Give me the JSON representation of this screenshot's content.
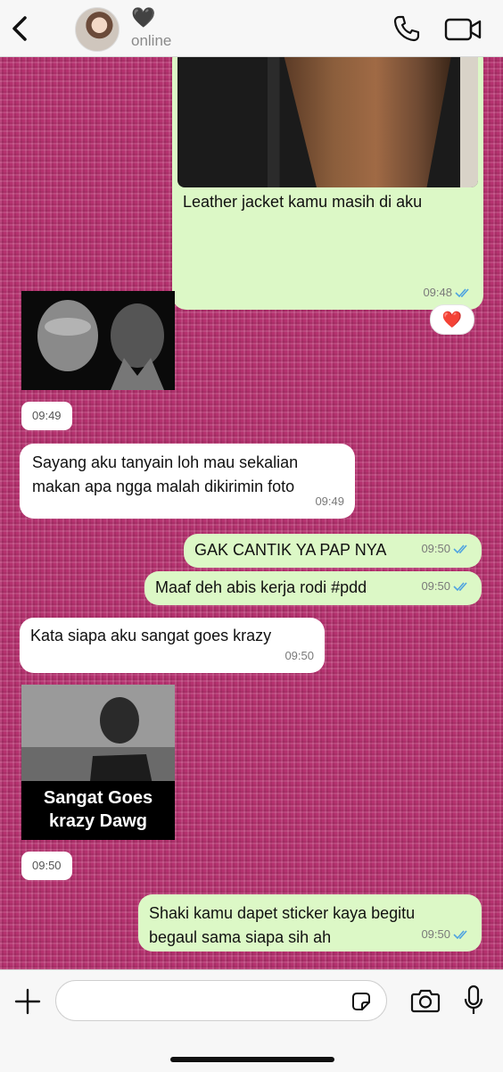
{
  "header": {
    "contact_name": "🖤",
    "status": "online"
  },
  "messages": {
    "m1": {
      "text": "Leather jacket kamu masih di aku",
      "time": "09:48",
      "reaction": "❤️"
    },
    "m2": {
      "time": "09:49"
    },
    "m3": {
      "text": "Sayang aku tanyain loh mau sekalian makan apa ngga malah dikirimin foto",
      "time": "09:49"
    },
    "m4": {
      "text": "GAK CANTIK YA PAP NYA",
      "time": "09:50"
    },
    "m5": {
      "text": "Maaf deh abis kerja rodi #pdd",
      "time": "09:50"
    },
    "m6": {
      "text": "Kata siapa aku sangat goes krazy",
      "time": "09:50"
    },
    "m7": {
      "caption": "Sangat Goes krazy Dawg",
      "time": "09:50"
    },
    "m8": {
      "text": "Shaki kamu dapet sticker kaya begitu begaul sama siapa sih ah",
      "time": "09:50"
    }
  },
  "composer": {
    "placeholder": ""
  },
  "colors": {
    "chat_bg": "#b5326f",
    "outgoing": "#dcf8c6",
    "incoming": "#ffffff",
    "read_ticks": "#4fa3e0"
  },
  "icons": [
    "back-chevron-icon",
    "phone-icon",
    "video-camera-icon",
    "plus-icon",
    "sticker-icon",
    "camera-icon",
    "microphone-icon",
    "double-check-icon"
  ]
}
